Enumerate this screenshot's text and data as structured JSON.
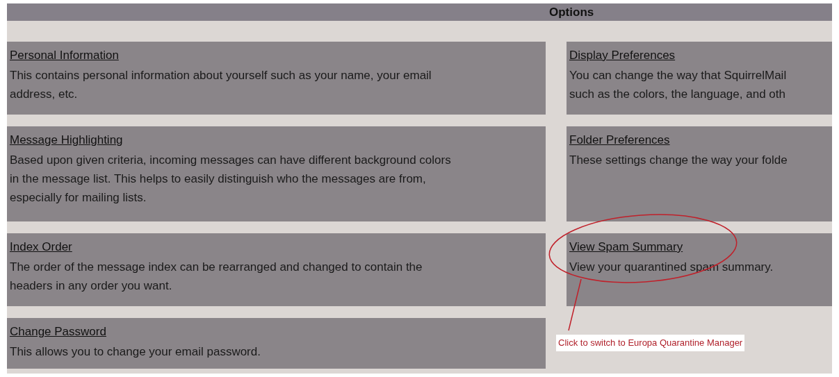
{
  "header": {
    "title": "Options"
  },
  "left_options": [
    {
      "title": "Personal Information",
      "description": [
        "This contains personal information about yourself such as your name, your email",
        "address, etc."
      ]
    },
    {
      "title": "Message Highlighting",
      "description": [
        "Based upon given criteria, incoming messages can have different background colors",
        "in the message list. This helps to easily distinguish who the messages are from,",
        "especially for mailing lists."
      ]
    },
    {
      "title": "Index Order",
      "description": [
        "The order of the message index can be rearranged and changed to contain the",
        "headers in any order you want."
      ]
    },
    {
      "title": "Change Password",
      "description": [
        "This allows you to change your email password."
      ]
    }
  ],
  "right_options": [
    {
      "title": "Display Preferences",
      "description": [
        "You can change the way that SquirrelMail",
        "such as the colors, the language, and oth"
      ]
    },
    {
      "title": "Folder Preferences",
      "description": [
        "These settings change the way your folde"
      ]
    },
    {
      "title": "View Spam Summary",
      "description": [
        "View your quarantined spam summary."
      ]
    }
  ],
  "annotation": {
    "callout": "Click to switch to Europa Quarantine Manager"
  }
}
